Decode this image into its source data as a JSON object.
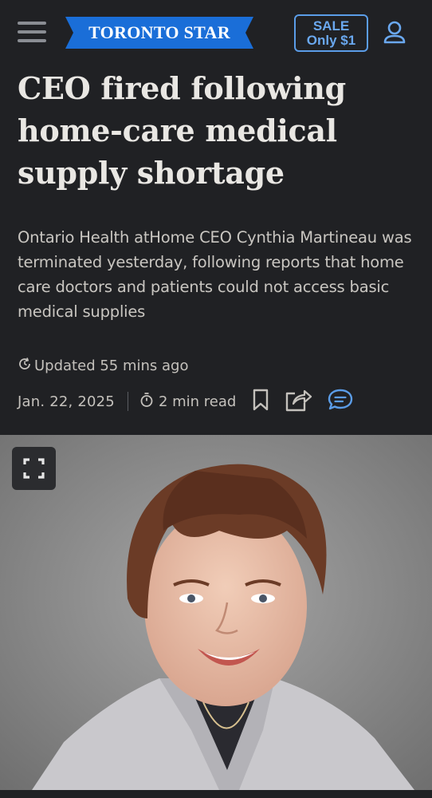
{
  "header": {
    "logo_text": "TORONTO STAR",
    "sale_line1": "SALE",
    "sale_line2": "Only $1",
    "brand_color": "#1a6ed8",
    "accent_color": "#5b9de8"
  },
  "article": {
    "headline": "CEO fired following home-care medical supply shortage",
    "summary": "Ontario Health atHome CEO Cynthia Martineau was terminated yesterday, following reports that home care doctors and patients could not access basic medical supplies",
    "updated": "Updated 55 mins ago",
    "date": "Jan. 22, 2025",
    "read_time": "2 min read"
  },
  "icons": {
    "menu": "hamburger-menu-icon",
    "user": "user-icon",
    "updated": "refresh-clock-icon",
    "read_time": "stopwatch-icon",
    "bookmark": "bookmark-icon",
    "share": "share-icon",
    "comment": "comment-icon",
    "expand": "expand-icon"
  }
}
